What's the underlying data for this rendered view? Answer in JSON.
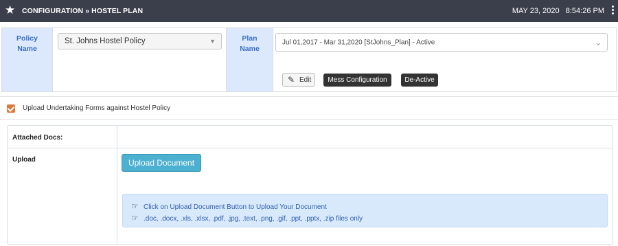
{
  "header": {
    "title": "CONFIGURATION » HOSTEL PLAN",
    "date": "MAY 23, 2020",
    "time": "8:54:26 PM",
    "star_icon": "star-icon",
    "menu_icon": "kebab-menu-icon"
  },
  "policy": {
    "label": "Policy\nName",
    "label_line1": "Policy",
    "label_line2": "Name",
    "selected": "St. Johns Hostel Policy"
  },
  "plan": {
    "label_line1": "Plan",
    "label_line2": "Name",
    "selected": "Jul 01,2017 - Mar 31,2020 [StJohns_Plan] - Active"
  },
  "actions": {
    "edit_label": "Edit",
    "mess_label": "Mess Configuration",
    "deactive_label": "De-Active"
  },
  "upload_undertaking": {
    "checked": true,
    "label": "Upload Undertaking Forms against Hostel Policy"
  },
  "docs": {
    "attached_label": "Attached Docs:",
    "upload_label": "Upload",
    "upload_button": "Upload Document",
    "info_line1": "Click on Upload Document Button to Upload Your Document",
    "info_line2": ".doc, .docx, .xls, .xlsx, .pdf, .jpg, .text, .png, .gif, .ppt, .pptx, .zip files only"
  },
  "colors": {
    "header_bg": "#3a3f4b",
    "label_bg": "#dce8fb",
    "label_text": "#3a6fc4",
    "checkbox": "#e07a3b",
    "upload_button": "#4cb0d0",
    "info_bg": "#d8e9fb"
  }
}
